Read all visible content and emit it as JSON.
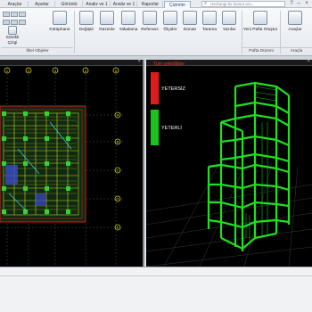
{
  "tabs": [
    "Araçlar",
    "Ayarlar",
    "Görüntü",
    "Analiz ve 1",
    "Analiz ve 1",
    "Raporlar",
    "Çizimler"
  ],
  "active_tab_index": 6,
  "search": {
    "placeholder": "Herhangi bir komut ara..."
  },
  "ribbon": {
    "buttons": [
      {
        "label": "Sürekli Çizgi",
        "icon": "polyline-icon"
      },
      {
        "label": "Kütüphane",
        "icon": "library-icon"
      },
      {
        "label": "Değiştir",
        "icon": "modify-icon"
      },
      {
        "label": "Düzenle",
        "icon": "edit-icon"
      },
      {
        "label": "Yakalama",
        "icon": "snap-icon"
      },
      {
        "label": "Referans",
        "icon": "reference-icon"
      },
      {
        "label": "Ölçüler",
        "icon": "dimensions-icon"
      },
      {
        "label": "Donatı",
        "icon": "rebar-icon"
      },
      {
        "label": "Tarama",
        "icon": "hatch-icon"
      },
      {
        "label": "Yazılar",
        "icon": "text-icon"
      },
      {
        "label": "Yeni Pafta Oluştur",
        "icon": "new-sheet-icon"
      },
      {
        "label": "Araçlar",
        "icon": "tools-icon"
      }
    ],
    "groups": [
      "İlkel Objeler",
      "Pafta Düzeni",
      "Araçla"
    ]
  },
  "legend": {
    "title": "Tüm yeterlilikler",
    "items": [
      {
        "label": "YETERSİZ",
        "color": "#e01b1b"
      },
      {
        "label": "YETERLİ",
        "color": "#19c51b"
      }
    ]
  },
  "plan": {
    "axes_top": [
      "1",
      "2",
      "3",
      "4",
      "5"
    ],
    "axes_right": [
      "A",
      "B",
      "C",
      "D",
      "E"
    ]
  }
}
